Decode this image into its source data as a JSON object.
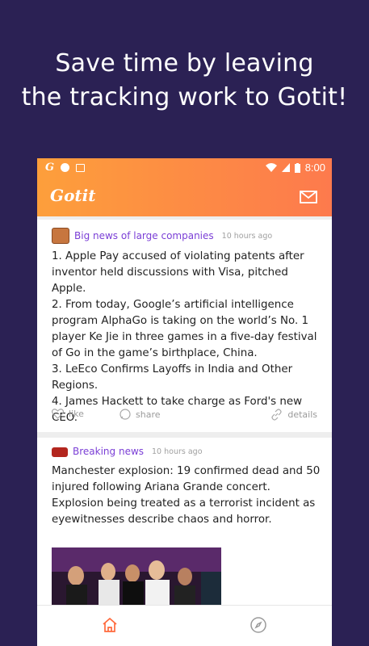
{
  "promo": {
    "line1": "Save time by leaving",
    "line2": "the tracking work to Gotit!"
  },
  "status_bar": {
    "left_icons": [
      "g-app-icon",
      "tt-app-icon",
      "image-icon"
    ],
    "right_icons": [
      "wifi-icon",
      "signal-icon",
      "battery-icon"
    ],
    "time": "8:00"
  },
  "app_bar": {
    "logo": "Gotit",
    "right_icon": "mail-icon"
  },
  "feed": {
    "card1": {
      "category": "Big news of large companies",
      "time": "10 hours ago",
      "body": "1. Apple Pay accused of violating patents after inventor held discussions with Visa, pitched Apple.\n2. From today, Google’s artificial intelligence program AlphaGo is taking on the world’s No. 1 player Ke Jie in three games in a five-day festival of Go in the game’s birthplace, China.\n3. LeEco Confirms Layoffs in India and Other Regions.\n4. James Hackett to take charge as Ford's new CEO.",
      "like": "like",
      "share": "share",
      "details": "details"
    },
    "card2": {
      "category": "Breaking news",
      "time": "10 hours ago",
      "body": "Manchester explosion: 19 confirmed dead and 50 injured following Ariana Grande concert.\nExplosion being treated as a terrorist incident as eyewitnesses describe chaos and horror."
    }
  },
  "bottom_nav": {
    "items": [
      "home-icon",
      "compass-icon"
    ],
    "active_color": "#ff6a3d"
  },
  "colors": {
    "background": "#2b2154",
    "accent": "#fd8a45",
    "category": "#7b3fd6"
  }
}
